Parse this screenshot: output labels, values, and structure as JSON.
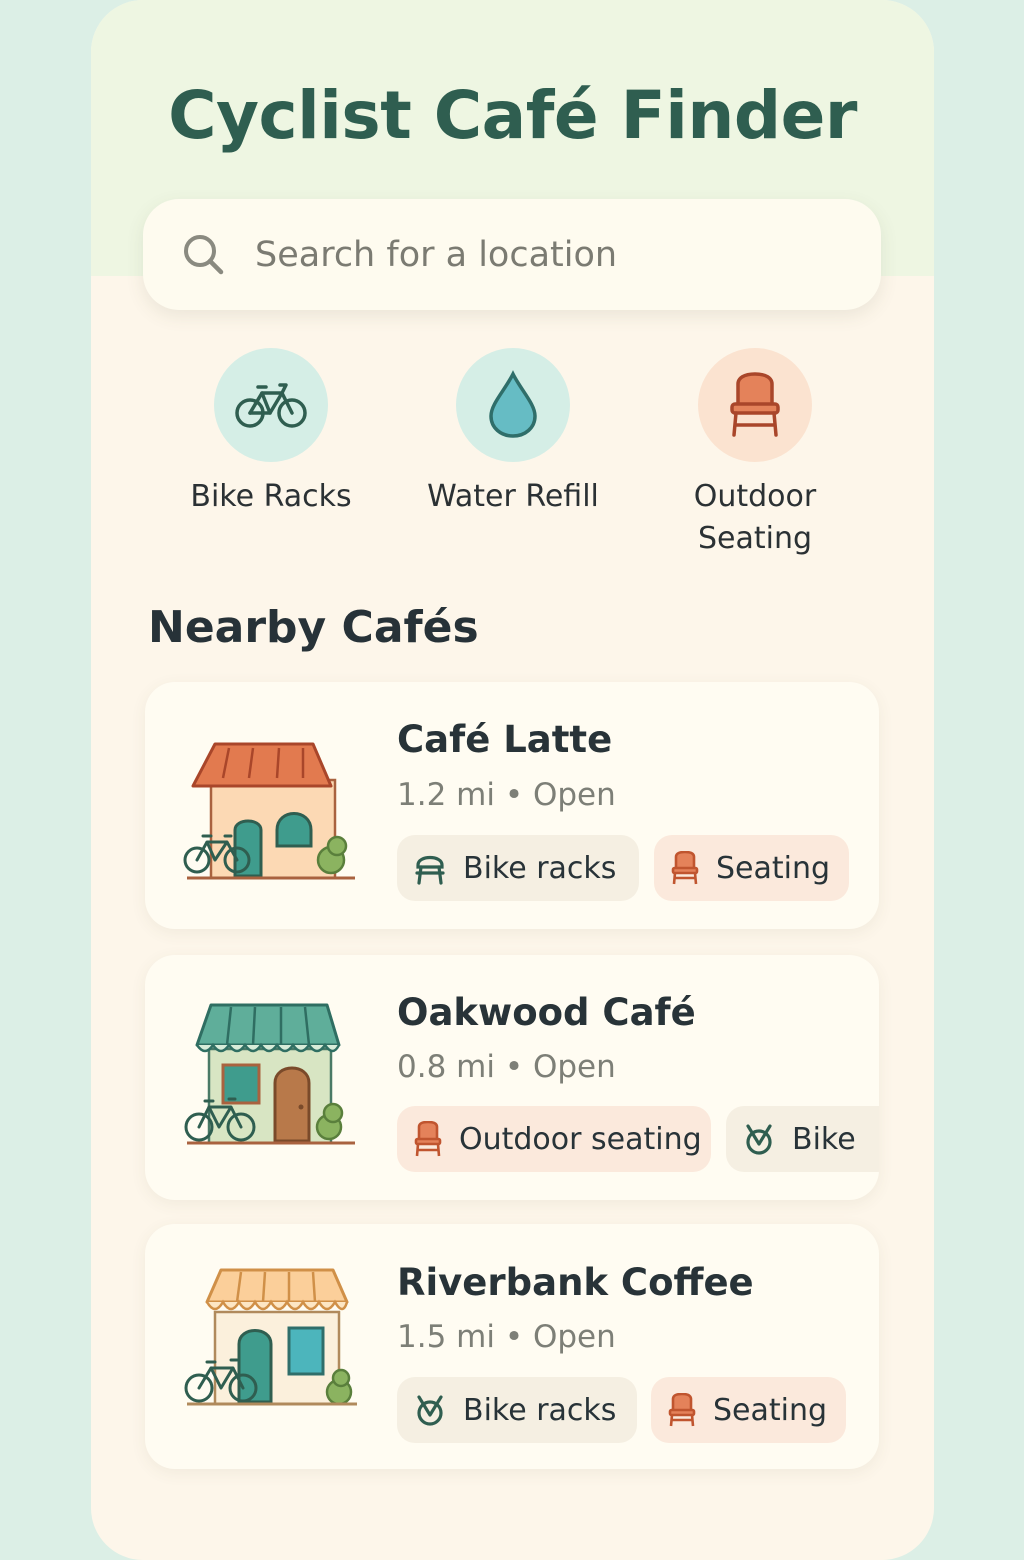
{
  "app": {
    "title": "Cyclist Café Finder"
  },
  "search": {
    "placeholder": "Search for a location",
    "icon": "search-icon"
  },
  "filters": [
    {
      "label": "Bike Racks",
      "icon": "bicycle-icon",
      "color": "#d5eee6"
    },
    {
      "label": "Water Refill",
      "icon": "water-drop-icon",
      "color": "#d5eee6"
    },
    {
      "label": "Outdoor Seating",
      "icon": "chair-icon",
      "color": "#fbe3d0"
    }
  ],
  "section": {
    "title": "Nearby Cafés"
  },
  "cafes": [
    {
      "name": "Café Latte",
      "meta": "1.2 mi • Open",
      "tags": [
        {
          "label": "Bike racks",
          "icon": "bike-rack-icon"
        },
        {
          "label": "Seating",
          "icon": "chair-icon"
        }
      ]
    },
    {
      "name": "Oakwood Café",
      "meta": "0.8 mi • Open",
      "tags": [
        {
          "label": "Outdoor seating",
          "icon": "chair-icon"
        },
        {
          "label": "Bike",
          "icon": "bike-lock-icon"
        }
      ]
    },
    {
      "name": "Riverbank Coffee",
      "meta": "1.5 mi • Open",
      "tags": [
        {
          "label": "Bike racks",
          "icon": "bike-lock-icon"
        },
        {
          "label": "Seating",
          "icon": "chair-icon"
        }
      ]
    }
  ],
  "colors": {
    "accent_green": "#2f5e50",
    "accent_orange": "#e07a4f",
    "background": "#fdf6ea"
  }
}
